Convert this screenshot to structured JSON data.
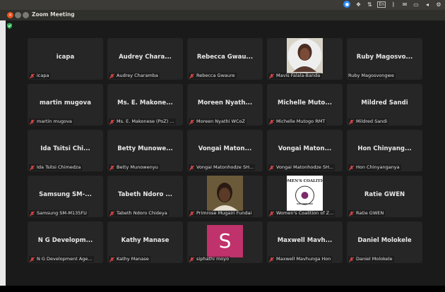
{
  "window": {
    "title": "Zoom Meeting"
  },
  "tray": {
    "lang": "En"
  },
  "colors": {
    "s_avatar": "#c0326b",
    "mute": "#e0484a"
  },
  "tiles": [
    {
      "name": "icapa",
      "label": "icapa"
    },
    {
      "name": "Audrey Chara...",
      "label": "Audrey Charamba"
    },
    {
      "name": "Rebecca Gwau...",
      "label": "Rebecca Gwaure"
    },
    {
      "name": "",
      "label": "Mavis Falala-Banda",
      "avatar": "photo-woman"
    },
    {
      "name": "Ruby Magosvo...",
      "label": "Ruby Magosvongwe",
      "nomute": true
    },
    {
      "name": "martin mugova",
      "label": "martin mugova"
    },
    {
      "name": "Ms. E. Makone...",
      "label": "Ms. E. Makonese (PoZ) ..."
    },
    {
      "name": "Moreen Nyath...",
      "label": "Moreen Nyathi WCoZ"
    },
    {
      "name": "Michelle Muto...",
      "label": "Michelle Mutogo RMT"
    },
    {
      "name": "Mildred Sandi",
      "label": "Mildred Sandi"
    },
    {
      "name": "Ida Tsitsi Chi...",
      "label": "Ida Tsitsi Chimedza"
    },
    {
      "name": "Betty Munowe...",
      "label": "Betty Munowenyu"
    },
    {
      "name": "Vongai Maton...",
      "label": "Vongai Matonhodze SH..."
    },
    {
      "name": "Vongai Maton...",
      "label": "Vongai Matonhodze SH..."
    },
    {
      "name": "Hon Chinyang...",
      "label": "Hon Chinyanganya"
    },
    {
      "name": "Samsung SM-...",
      "label": "Samsung SM-M135FU"
    },
    {
      "name": "Tabeth Ndoro ...",
      "label": "Tabeth Ndoro Chideya"
    },
    {
      "name": "",
      "label": "Primrose Mugairi Fundai",
      "avatar": "photo-child"
    },
    {
      "name": "",
      "label": "Women's Coalition of Z...",
      "avatar": "logo",
      "logo_text": "OMEN'S COALITIO"
    },
    {
      "name": "Ratie GWEN",
      "label": "Ratie GWEN"
    },
    {
      "name": "N G Developm...",
      "label": "N G Development Age..."
    },
    {
      "name": "Kathy Manase",
      "label": "Kathy Manase"
    },
    {
      "name": "",
      "label": "siphathi moyo",
      "avatar": "letter",
      "letter": "S"
    },
    {
      "name": "Maxwell Mavh...",
      "label": "Maxwell Mavhunga Hon"
    },
    {
      "name": "Daniel Molokele",
      "label": "Daniel Molokele"
    }
  ]
}
